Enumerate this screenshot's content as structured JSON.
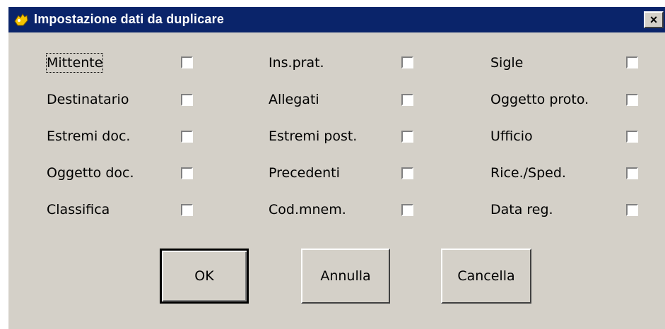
{
  "dialog": {
    "title": "Impostazione dati da duplicare",
    "close_glyph": "×"
  },
  "checkboxes": {
    "col1": [
      "Mittente",
      "Destinatario",
      "Estremi doc.",
      "Oggetto doc.",
      "Classifica"
    ],
    "col2": [
      "Ins.prat.",
      "Allegati",
      "Estremi post.",
      "Precedenti",
      "Cod.mnem."
    ],
    "col3": [
      "Sigle",
      "Oggetto proto.",
      "Ufficio",
      "Rice./Sped.",
      "Data reg."
    ],
    "checked": false
  },
  "buttons": {
    "ok": "OK",
    "annulla": "Annulla",
    "cancella": "Cancella"
  },
  "colors": {
    "titlebar": "#0a246a",
    "face": "#d4d0c8"
  }
}
